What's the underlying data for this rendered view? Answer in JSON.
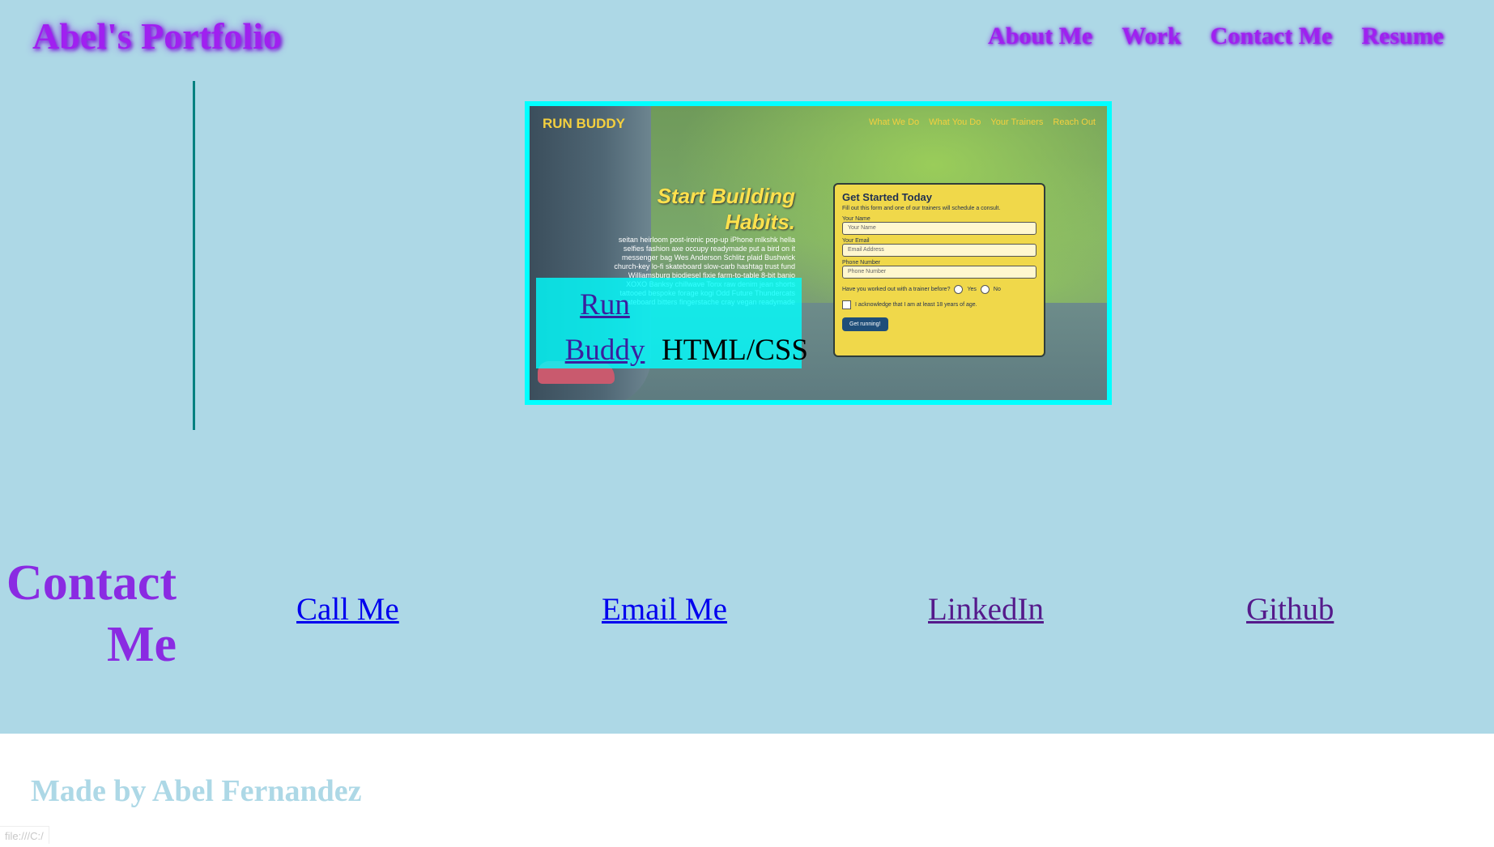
{
  "header": {
    "title": "Abel's Portfolio",
    "nav": [
      "About Me",
      "Work",
      "Contact Me",
      "Resume"
    ]
  },
  "work": {
    "project": {
      "link_label": "Run Buddy",
      "tech": "HTML/CSS",
      "screenshot": {
        "brand": "RUN BUDDY",
        "nav": [
          "What We Do",
          "What You Do",
          "Your Trainers",
          "Reach Out"
        ],
        "headline_line1": "Start Building",
        "headline_line2": "Habits.",
        "body": "seitan heirloom post-ironic pop-up iPhone mlkshk hella selfies fashion axe occupy readymade put a bird on it messenger bag Wes Anderson Schlitz plaid Bushwick church-key lo-fi skateboard slow-carb hashtag trust fund Williamsburg biodiesel fixie farm-to-table 8-bit banjo XOXO Banksy chillwave Tonx raw denim jean shorts tattooed bespoke forage kogi Odd Future Thundercats skateboard bitters fingerstache cray vegan readymade",
        "form": {
          "title": "Get Started Today",
          "subtitle": "Fill out this form and one of our trainers will schedule a consult.",
          "name_label": "Your Name",
          "name_placeholder": "Your Name",
          "email_label": "Your Email",
          "email_placeholder": "Email Address",
          "phone_label": "Phone Number",
          "phone_placeholder": "Phone Number",
          "trainer_question": "Have you worked out with a trainer before?",
          "yes": "Yes",
          "no": "No",
          "acknowledge": "I acknowledge that I am at least 18 years of age.",
          "button": "Get running!"
        }
      }
    }
  },
  "contact": {
    "title_line1": "Contact",
    "title_line2": "Me",
    "links": {
      "call": "Call Me",
      "email": "Email Me",
      "linkedin": "LinkedIn",
      "github": "Github"
    }
  },
  "footer": {
    "text": "Made by Abel Fernandez"
  },
  "status_bar": {
    "url": "file:///C:/"
  },
  "colors": {
    "page_background": "#add8e6",
    "accent_purple": "#a020f0",
    "project_border": "#00ffff",
    "work_line": "#008080"
  }
}
